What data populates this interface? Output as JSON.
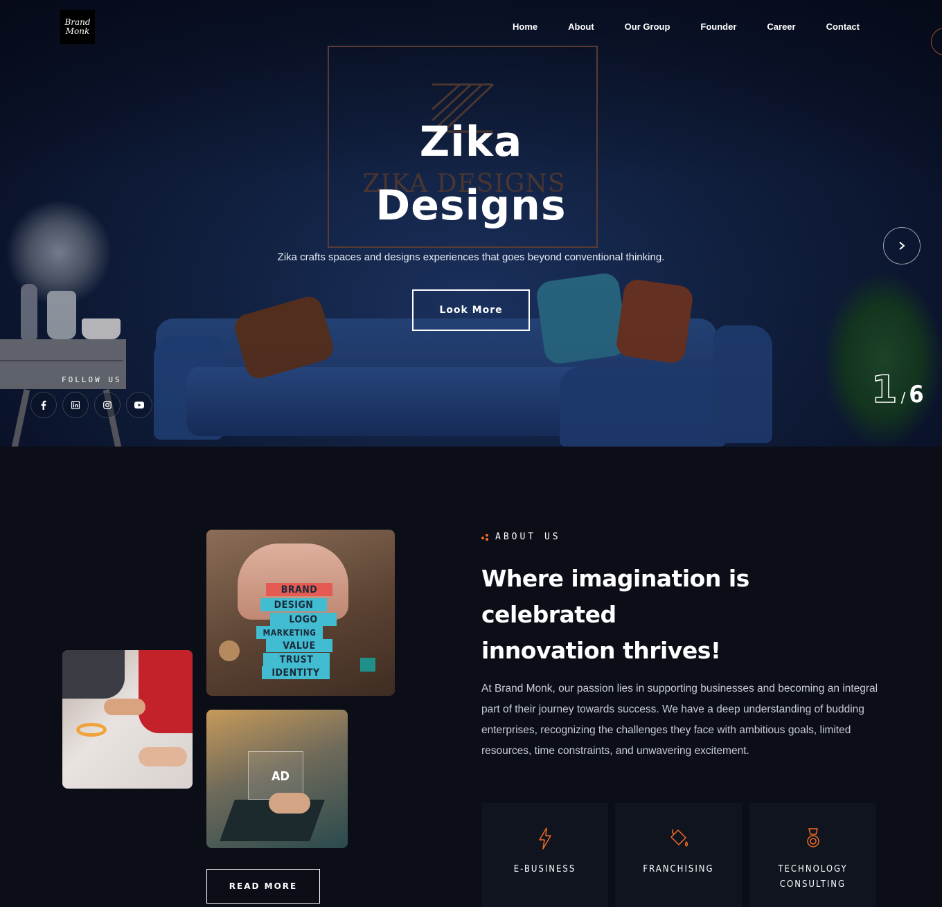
{
  "brand": {
    "logo_line1": "Brand",
    "logo_line2": "Monk"
  },
  "nav": {
    "items": [
      {
        "label": "Home"
      },
      {
        "label": "About"
      },
      {
        "label": "Our Group"
      },
      {
        "label": "Founder"
      },
      {
        "label": "Career"
      },
      {
        "label": "Contact"
      }
    ]
  },
  "hero": {
    "title_line1": "Zika",
    "title_line2": "Designs",
    "ghost_text": "ZIKA DESIGNS",
    "subtitle": "Zika crafts spaces and designs experiences that goes beyond conventional thinking.",
    "button_label": "Look More",
    "follow_label": "FOLLOW US",
    "social_icons": [
      "facebook-icon",
      "linkedin-icon",
      "instagram-icon",
      "youtube-icon"
    ],
    "slide_current": "1",
    "slide_separator": "/",
    "slide_total": "6"
  },
  "about": {
    "tag": "ABOUT US",
    "heading_line1": "Where imagination is",
    "heading_line2": "celebrated",
    "heading_line3": "innovation thrives!",
    "paragraph": "At Brand Monk, our passion lies in supporting businesses and becoming an integral part of their journey towards success. We have a deep understanding of budding enterprises, recognizing the challenges they face with ambitious goals, limited resources, time constraints, and unwavering excitement.",
    "read_more_label": "READ MORE",
    "brand_blocks": [
      "BRAND",
      "DESIGN",
      "LOGO",
      "MARKETING",
      "VALUE",
      "TRUST",
      "IDENTITY"
    ],
    "ad_label": "AD",
    "services": [
      {
        "icon": "lightning-icon",
        "label": "E-BUSINESS"
      },
      {
        "icon": "paint-bucket-icon",
        "label": "FRANCHISING"
      },
      {
        "icon": "medal-icon",
        "label_line1": "TECHNOLOGY",
        "label_line2": "CONSULTING"
      }
    ]
  },
  "colors": {
    "accent": "#f26b21",
    "background": "#0b0e17",
    "hero_blue": "#1d3566"
  }
}
